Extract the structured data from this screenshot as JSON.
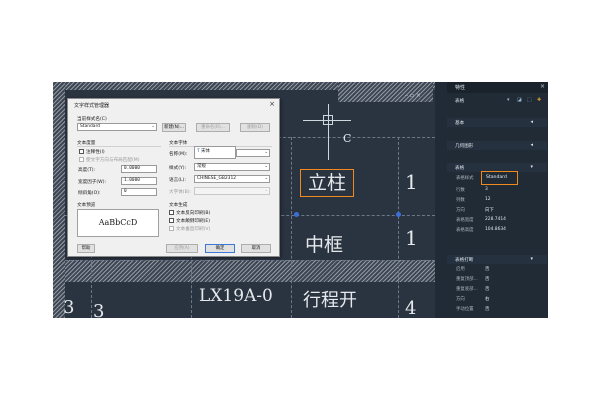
{
  "colors": {
    "panel_bg": "#212b36",
    "canvas_bg": "#2a3340",
    "highlight": "#f08a1d",
    "accent": "#3b6fd8"
  },
  "canvas": {
    "column_letter": "C",
    "rows": [
      {
        "left_num": "1",
        "left_num2": "",
        "main": "立柱",
        "right": "1"
      },
      {
        "left_num": "",
        "left_num2": "",
        "main": "中框",
        "right": "1"
      },
      {
        "left_num": "3",
        "left_num2": "3",
        "main": "LX19A-0",
        "main2": "行程开",
        "right": "4"
      }
    ]
  },
  "panel": {
    "title": "特性",
    "header_value": "表格",
    "sections": {
      "basic": "基本",
      "geometry": "几何图形",
      "table": "表格",
      "table_break": "表格打断"
    },
    "table_props": [
      {
        "label": "表格样式",
        "value": "Standard"
      },
      {
        "label": "行数",
        "value": "3"
      },
      {
        "label": "列数",
        "value": "12"
      },
      {
        "label": "方向",
        "value": "向下"
      },
      {
        "label": "表格宽度",
        "value": "228.7414"
      },
      {
        "label": "表格高度",
        "value": "104.8634"
      }
    ],
    "break_props": [
      {
        "label": "启用",
        "value": "否"
      },
      {
        "label": "重复顶部...",
        "value": "否"
      },
      {
        "label": "重复底部...",
        "value": "否"
      },
      {
        "label": "方向",
        "value": "右"
      },
      {
        "label": "手动位置",
        "value": "否"
      }
    ],
    "close_icon": "×",
    "collapse_icon": "◂"
  },
  "dialog": {
    "title": "文字样式管理器",
    "current_style_label": "当前样式名(C)",
    "current_style_value": "Standard",
    "buttons": {
      "new": "新建(N)...",
      "rename": "重命名(R)...",
      "delete": "删除(D)",
      "apply": "应用(A)",
      "ok": "确定",
      "cancel": "取消",
      "help": "帮助"
    },
    "height_group": "文本度量",
    "annotative": "注释性(I)",
    "match_orient": "使文字方向与布局匹配(M)",
    "height_label": "高度(T):",
    "height_value": "0.0000",
    "width_label": "宽度因子(W):",
    "width_value": "1.0000",
    "oblique_label": "倾斜角(O):",
    "oblique_value": "0",
    "font_group": "文本字体",
    "font_name_label": "名称(M):",
    "font_name_value": "宋体",
    "font_style_label": "样式(Y):",
    "font_style_value": "常规",
    "language_label": "语言(L):",
    "language_value": "CHINESE_GB2312",
    "bigfont_label": "大字体(B):",
    "bigfont_value": "",
    "preview_group": "文本预览",
    "preview_text": "AaBbCcD",
    "generate_group": "文本生成",
    "upside_down": "文本反向印刷(B)",
    "backwards": "文本颠倒印刷(E)",
    "vertical": "文本垂直印刷(V)"
  }
}
